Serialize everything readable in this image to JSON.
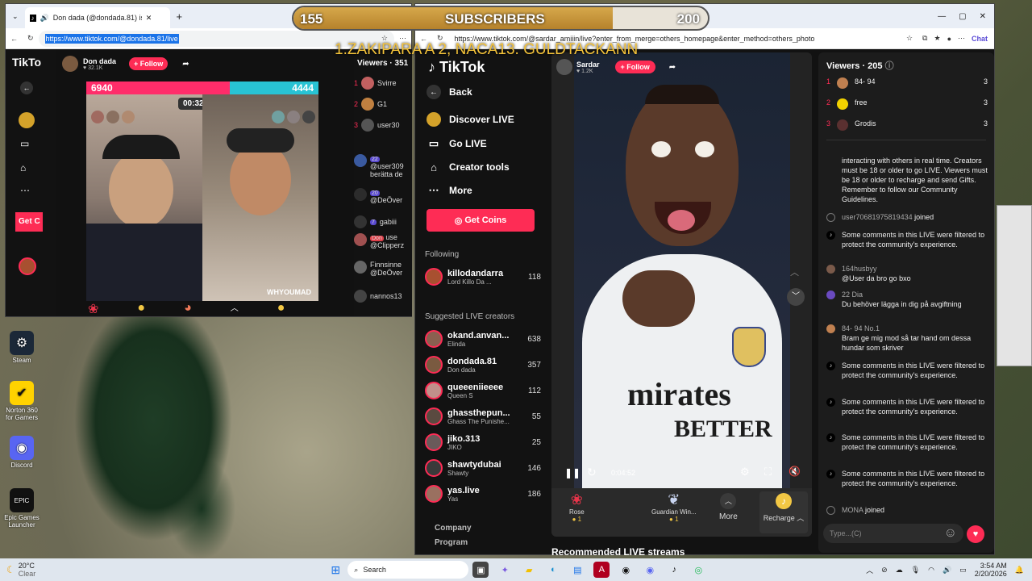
{
  "overlay": {
    "sub_left": "155",
    "sub_title": "SUBSCRIBERS",
    "sub_right": "200",
    "sub_progress": 0.77,
    "marquee": "1.ZAKIPARA A 2, NACA13. GULDTACKANN"
  },
  "left_browser": {
    "tab_title": "Don dada (@dondada.81) is LIVE",
    "url": "https://www.tiktok.com/@dondada.81/live",
    "logo": "TikTo",
    "streamer_name": "Don dada",
    "streamer_likes": "32.1K",
    "follow_label": "+ Follow",
    "pk_left": "6940",
    "pk_right": "4444",
    "pk_timer": "00:32",
    "watermark": "WHYOUMAD",
    "viewers_label": "Viewers · 351",
    "get_coins_short": "Get C",
    "viewers": [
      {
        "rank": "1",
        "name": "Svirre"
      },
      {
        "rank": "2",
        "name": "G1"
      },
      {
        "rank": "3",
        "name": "user30"
      }
    ],
    "chat": [
      {
        "badge": "22",
        "name": "@user309",
        "text": "berätta de"
      },
      {
        "badge": "20",
        "name": "@DeÖver",
        "text": ""
      },
      {
        "badge": "7",
        "name": "gabiii",
        "text": ""
      },
      {
        "badge": "Don",
        "name": "@Clipperz",
        "text": "use"
      },
      {
        "badge": "",
        "name": "Finnsinne",
        "text": "@DeÖver"
      },
      {
        "badge": "",
        "name": "nannos13",
        "text": ""
      }
    ]
  },
  "right_browser": {
    "url": "https://www.tiktok.com/@sardar_amiiin/live?enter_from_merge=others_homepage&enter_method=others_photo",
    "chat_btn": "Chat",
    "logo": "TikTok",
    "nav": {
      "back": "Back",
      "discover": "Discover LIVE",
      "go_live": "Go LIVE",
      "creator_tools": "Creator tools",
      "more": "More"
    },
    "get_coins": "Get Coins",
    "following_title": "Following",
    "following": [
      {
        "name": "killodandarra",
        "sub": "Lord Killo Da ...",
        "count": "118"
      }
    ],
    "suggested_title": "Suggested LIVE creators",
    "suggested": [
      {
        "name": "okand.anvan...",
        "sub": "Elinda",
        "count": "638"
      },
      {
        "name": "dondada.81",
        "sub": "Don dada",
        "count": "357"
      },
      {
        "name": "queeeniieeee",
        "sub": "Queen S",
        "count": "112"
      },
      {
        "name": "ghassthepun...",
        "sub": "Ghass The Punishe...",
        "count": "55"
      },
      {
        "name": "jiko.313",
        "sub": "JIKO",
        "count": "25"
      },
      {
        "name": "shawtydubai",
        "sub": "Shawty",
        "count": "146"
      },
      {
        "name": "yas.live",
        "sub": "Yas",
        "count": "186"
      }
    ],
    "footer": {
      "company": "Company",
      "program": "Program"
    },
    "stream": {
      "host_name": "Sardar",
      "host_likes": "1.2K",
      "follow_label": "+ Follow",
      "time": "0:04:52",
      "jersey_text": "mirates",
      "jersey_text2": "BETTER"
    },
    "gifts": [
      {
        "name": "Rose",
        "price": "1"
      },
      {
        "name": "Guardian Win...",
        "price": "1"
      }
    ],
    "more_label": "More",
    "recharge_label": "Recharge",
    "recommended": "Recommended LIVE streams",
    "viewers_label": "Viewers · 205",
    "top_viewers": [
      {
        "rank": "1",
        "name": "84- 94",
        "count": "3"
      },
      {
        "rank": "2",
        "name": "free",
        "count": "3"
      },
      {
        "rank": "3",
        "name": "Grodis",
        "count": "3"
      }
    ],
    "chat": [
      {
        "type": "notice",
        "name": "",
        "text": "interacting with others in real time. Creators must be 18 or older to go LIVE. Viewers must be 18 or older to recharge and send Gifts. Remember to follow our Community Guidelines."
      },
      {
        "type": "join",
        "name": "user70681975819434",
        "text": "joined"
      },
      {
        "type": "notice",
        "name": "",
        "text": "Some comments in this LIVE were filtered to protect the community's experience."
      },
      {
        "type": "msg",
        "name": "164husbyy",
        "text": "@User da bro go bxo"
      },
      {
        "type": "msg",
        "name": "22 Dia",
        "text": "Du behöver lägga in dig på avgiftning"
      },
      {
        "type": "msg",
        "name": "84- 94  No.1",
        "text": "Bram ge mig mod så tar hand om dessa hundar som skriver"
      },
      {
        "type": "notice",
        "name": "",
        "text": "Some comments in this LIVE were filtered to protect the community's experience."
      },
      {
        "type": "notice",
        "name": "",
        "text": "Some comments in this LIVE were filtered to protect the community's experience."
      },
      {
        "type": "notice",
        "name": "",
        "text": "Some comments in this LIVE were filtered to protect the community's experience."
      },
      {
        "type": "notice",
        "name": "",
        "text": "Some comments in this LIVE were filtered to protect the community's experience."
      },
      {
        "type": "join",
        "name": "MONA",
        "text": "joined"
      }
    ],
    "chat_placeholder": "Type...(C)"
  },
  "desktop_icons": [
    {
      "label": "Steam"
    },
    {
      "label": "Norton 360 for Gamers"
    },
    {
      "label": "Discord"
    },
    {
      "label": "Epic Games Launcher"
    }
  ],
  "taskbar": {
    "weather_temp": "20°C",
    "weather_desc": "Clear",
    "search_label": "Search",
    "time": "3:54 AM",
    "date": "2/20/2026"
  }
}
